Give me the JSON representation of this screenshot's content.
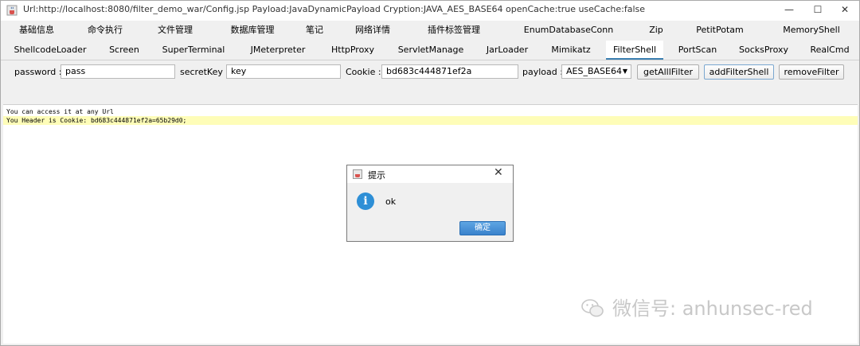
{
  "window": {
    "title": "Url:http://localhost:8080/filter_demo_war/Config.jsp Payload:JavaDynamicPayload Cryption:JAVA_AES_BASE64 openCache:true useCache:false",
    "min_glyph": "—",
    "max_glyph": "☐",
    "close_glyph": "✕"
  },
  "tabs_row1": [
    "基础信息",
    "命令执行",
    "文件管理",
    "数据库管理",
    "笔记",
    "网络详情",
    "插件标签管理",
    "EnumDatabaseConn",
    "Zip",
    "PetitPotam",
    "MemoryShell"
  ],
  "tabs_row2": [
    "ShellcodeLoader",
    "Screen",
    "SuperTerminal",
    "JMeterpreter",
    "HttpProxy",
    "ServletManage",
    "JarLoader",
    "Mimikatz",
    "FilterShell",
    "PortScan",
    "SocksProxy",
    "RealCmd"
  ],
  "active_tab": "FilterShell",
  "form": {
    "password_label": "password :",
    "password_value": "pass",
    "secretkey_label": "secretKey :",
    "secretkey_value": "key",
    "cookie_label": "Cookie :",
    "cookie_value": "bd683c444871ef2a",
    "payload_label": "payload :",
    "payload_value": "AES_BASE64"
  },
  "buttons": {
    "get_all_filter": "getAlllFilter",
    "add_filter_shell": "addFilterShell",
    "remove_filter": "removeFilter"
  },
  "output": {
    "lines": [
      "You can access it at any Url",
      "You Header is Cookie: bd683c444871ef2a=65b29d0;"
    ]
  },
  "dialog": {
    "title": "提示",
    "close_glyph": "✕",
    "info_glyph": "i",
    "message": "ok",
    "ok_label": "确定"
  },
  "watermark": {
    "text": "微信号: anhunsec-red"
  },
  "colors": {
    "highlight": "#fefdb8",
    "active_tab_underline": "#3c7fb1",
    "info_icon": "#2e8fd6",
    "ok_button": "#3a82cc"
  }
}
